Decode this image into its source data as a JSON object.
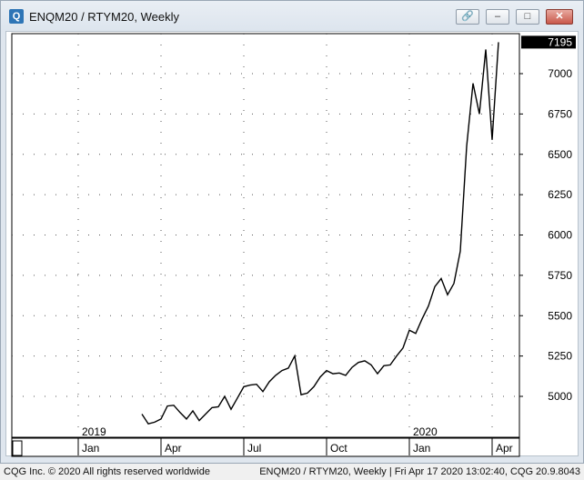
{
  "window": {
    "title": "ENQM20 / RTYM20, Weekly",
    "icon": "app-logo-icon",
    "buttons": {
      "link_icon": "link-icon",
      "minimize": "–",
      "maximize": "□",
      "close": "✕"
    }
  },
  "footer": {
    "left": "CQG Inc. © 2020 All rights reserved worldwide",
    "right": "ENQM20 / RTYM20, Weekly | Fri Apr 17 2020 13:02:40, CQG 20.9.8043"
  },
  "chart_data": {
    "type": "line",
    "title": "",
    "xlabel": "",
    "ylabel": "",
    "ylim": [
      4800,
      7300
    ],
    "y_ticks": [
      5000,
      5250,
      5500,
      5750,
      6000,
      6250,
      6500,
      6750,
      7000
    ],
    "y_tick_labels": [
      "5000",
      "5250",
      "5500",
      "5750",
      "6000",
      "6250",
      "6500",
      "6750",
      "7000"
    ],
    "last_value_label": "7195",
    "last_value": 7195,
    "x_tick_labels": [
      "Jan",
      "Apr",
      "Jul",
      "Oct",
      "Jan",
      "Apr"
    ],
    "x_tick_weeks": [
      0,
      13,
      26,
      39,
      52,
      65
    ],
    "year_labels": [
      {
        "label": "2019",
        "week": 0
      },
      {
        "label": "2020",
        "week": 52
      }
    ],
    "grid": true,
    "series": [
      {
        "values": [
          [
            10,
            4890
          ],
          [
            11,
            4830
          ],
          [
            12,
            4840
          ],
          [
            13,
            4860
          ],
          [
            14,
            4940
          ],
          [
            15,
            4945
          ],
          [
            16,
            4900
          ],
          [
            17,
            4860
          ],
          [
            18,
            4910
          ],
          [
            19,
            4850
          ],
          [
            20,
            4890
          ],
          [
            21,
            4930
          ],
          [
            22,
            4935
          ],
          [
            23,
            5000
          ],
          [
            24,
            4920
          ],
          [
            25,
            4990
          ],
          [
            26,
            5060
          ],
          [
            27,
            5070
          ],
          [
            28,
            5075
          ],
          [
            29,
            5030
          ],
          [
            30,
            5090
          ],
          [
            31,
            5130
          ],
          [
            32,
            5160
          ],
          [
            33,
            5175
          ],
          [
            34,
            5250
          ],
          [
            35,
            5010
          ],
          [
            36,
            5020
          ],
          [
            37,
            5060
          ],
          [
            38,
            5120
          ],
          [
            39,
            5160
          ],
          [
            40,
            5140
          ],
          [
            41,
            5145
          ],
          [
            42,
            5130
          ],
          [
            43,
            5180
          ],
          [
            44,
            5210
          ],
          [
            45,
            5220
          ],
          [
            46,
            5195
          ],
          [
            47,
            5140
          ],
          [
            48,
            5190
          ],
          [
            49,
            5195
          ],
          [
            50,
            5250
          ],
          [
            51,
            5300
          ],
          [
            52,
            5410
          ],
          [
            53,
            5390
          ],
          [
            54,
            5480
          ],
          [
            55,
            5560
          ],
          [
            56,
            5680
          ],
          [
            57,
            5730
          ],
          [
            58,
            5630
          ],
          [
            59,
            5700
          ],
          [
            60,
            5900
          ],
          [
            61,
            6550
          ],
          [
            62,
            6940
          ],
          [
            63,
            6750
          ],
          [
            64,
            7150
          ],
          [
            65,
            6590
          ],
          [
            66,
            7195
          ]
        ]
      }
    ]
  }
}
